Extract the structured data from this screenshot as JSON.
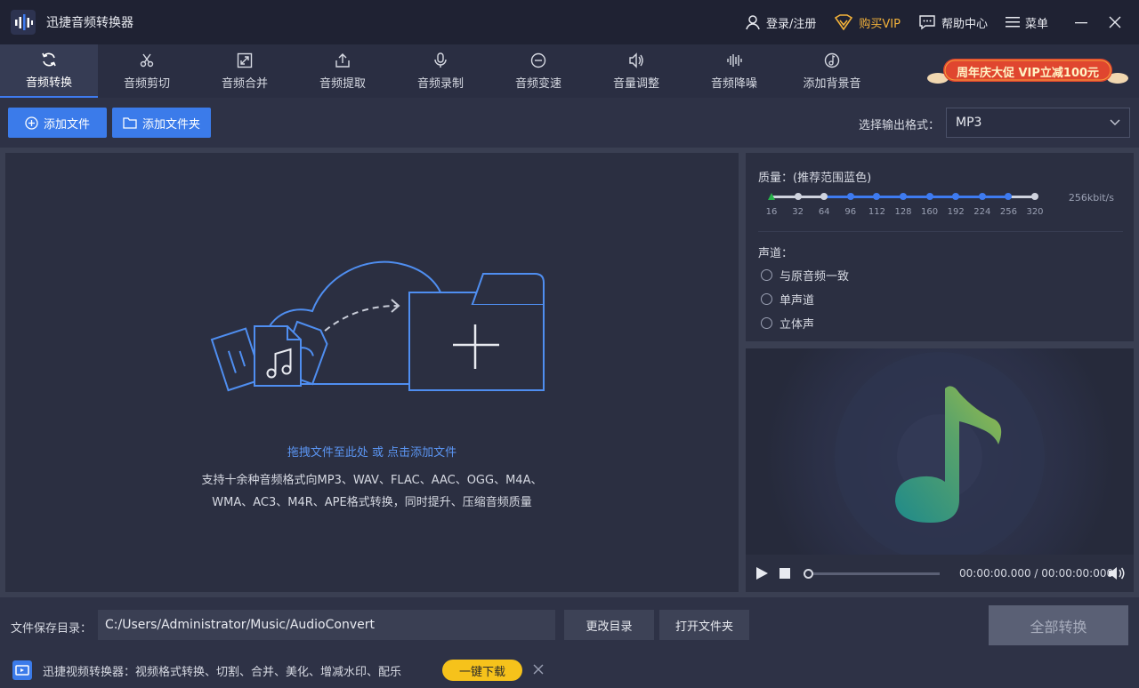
{
  "window": {
    "title": "迅捷音频转换器",
    "login_label": "登录/注册",
    "vip_label": "购买VIP",
    "help_label": "帮助中心",
    "menu_label": "菜单"
  },
  "toolbar": {
    "tabs": [
      {
        "label": "音频转换",
        "icon": "refresh-icon",
        "active": true
      },
      {
        "label": "音频剪切",
        "icon": "scissors-icon"
      },
      {
        "label": "音频合并",
        "icon": "merge-icon"
      },
      {
        "label": "音频提取",
        "icon": "extract-icon"
      },
      {
        "label": "音频录制",
        "icon": "microphone-icon"
      },
      {
        "label": "音频变速",
        "icon": "speed-icon"
      },
      {
        "label": "音量调整",
        "icon": "volume-icon"
      },
      {
        "label": "音频降噪",
        "icon": "waveform-icon"
      },
      {
        "label": "添加背景音",
        "icon": "background-music-icon"
      }
    ],
    "promo_text": "周年庆大促 VIP立减100元"
  },
  "actions": {
    "add_file": "添加文件",
    "add_folder": "添加文件夹",
    "format_label": "选择输出格式：",
    "format_value": "MP3"
  },
  "drop_zone": {
    "link_text": "拖拽文件至此处 或 点击添加文件",
    "desc_line1": "支持十余种音频格式向MP3、WAV、FLAC、AAC、OGG、M4A、",
    "desc_line2": "WMA、AC3、M4R、APE格式转换，同时提升、压缩音频质量"
  },
  "settings": {
    "quality_label": "质量：(推荐范围蓝色)",
    "quality_levels": [
      "16",
      "32",
      "64",
      "96",
      "112",
      "128",
      "160",
      "192",
      "224",
      "256",
      "320"
    ],
    "quality_selected": "16",
    "bitrate_readout": "256kbit/s",
    "channel_label": "声道：",
    "channels": [
      "与原音频一致",
      "单声道",
      "立体声"
    ],
    "colors": {
      "recommended": "#3e7bf0",
      "selected": "#27b34a",
      "other": "#cfd3de"
    }
  },
  "player": {
    "time": "00:00:00.000 / 00:00:00:000"
  },
  "bottom": {
    "save_label": "文件保存目录：",
    "save_path": "C:/Users/Administrator/Music/AudioConvert",
    "change_dir": "更改目录",
    "open_folder": "打开文件夹",
    "convert_all": "全部转换",
    "ad_text": "迅捷视频转换器：视频格式转换、切割、合并、美化、增减水印、配乐",
    "ad_button": "一键下载"
  }
}
